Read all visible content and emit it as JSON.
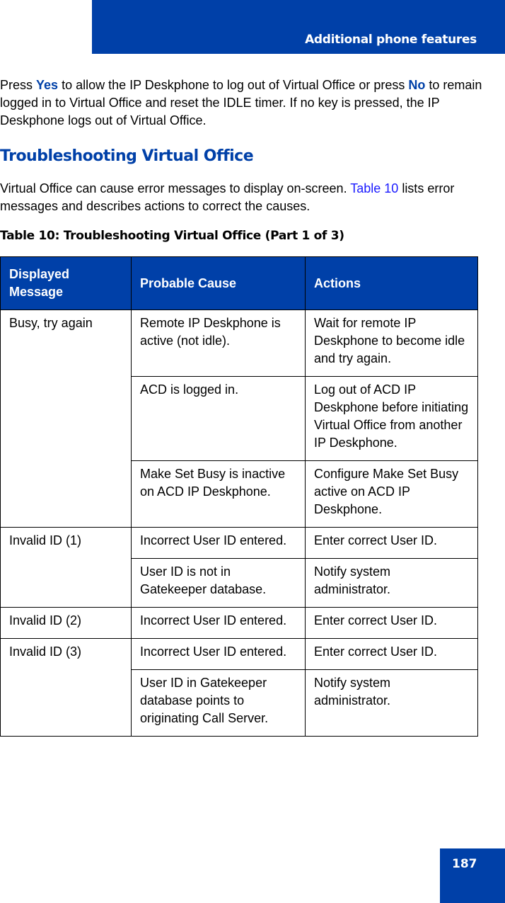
{
  "header": {
    "title": "Additional phone features"
  },
  "intro": {
    "t1": "Press ",
    "yes": "Yes",
    "t2": " to allow the IP Deskphone to log out of Virtual Office or press ",
    "no": "No",
    "t3": " to remain logged in to Virtual Office and reset the IDLE timer. If no key is pressed, the IP Deskphone logs out of Virtual Office."
  },
  "section": {
    "heading": "Troubleshooting Virtual Office",
    "p1": "Virtual Office can cause error messages to display on-screen. ",
    "link": "Table 10",
    "p2": " lists error messages and describes actions to correct the causes."
  },
  "table": {
    "caption": "Table 10: Troubleshooting Virtual Office (Part 1 of 3)",
    "headers": [
      "Displayed Message",
      "Probable Cause",
      "Actions"
    ],
    "groups": [
      {
        "message": "Busy, try again",
        "rows": [
          {
            "cause": "Remote IP Deskphone is active (not idle).",
            "action": "Wait for remote IP Deskphone to become idle and try again."
          },
          {
            "cause": "ACD is logged in.",
            "action": "Log out of ACD IP Deskphone before initiating Virtual Office from another IP Deskphone."
          },
          {
            "cause": "Make Set Busy is inactive on ACD IP Deskphone.",
            "action": "Configure Make Set Busy active on ACD IP Deskphone."
          }
        ]
      },
      {
        "message": "Invalid ID (1)",
        "rows": [
          {
            "cause": "Incorrect User ID entered.",
            "action": "Enter correct User ID."
          },
          {
            "cause": "User ID is not in Gatekeeper database.",
            "action": "Notify system administrator."
          }
        ]
      },
      {
        "message": "Invalid ID (2)",
        "rows": [
          {
            "cause": "Incorrect User ID entered.",
            "action": "Enter correct User ID."
          }
        ]
      },
      {
        "message": "Invalid ID (3)",
        "rows": [
          {
            "cause": "Incorrect User ID entered.",
            "action": "Enter correct User ID."
          },
          {
            "cause": "User ID in Gatekeeper database points to originating Call Server.",
            "action": "Notify system administrator."
          }
        ]
      }
    ]
  },
  "footer": {
    "page_number": "187"
  }
}
